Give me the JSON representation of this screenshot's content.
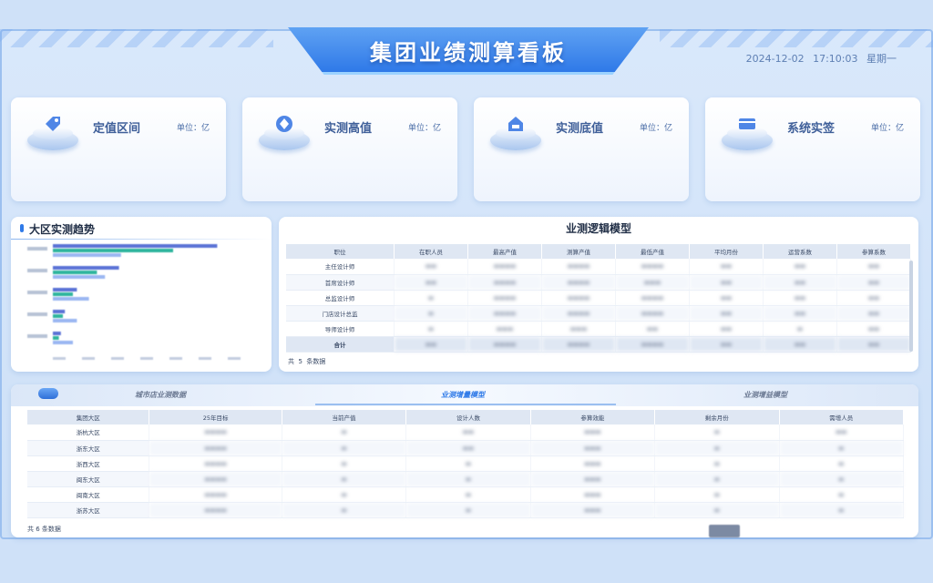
{
  "header": {
    "title": "集团业绩测算看板",
    "date": "2024-12-02",
    "time": "17:10:03",
    "weekday": "星期一"
  },
  "kpis": [
    {
      "label": "定值区间",
      "unit": "单位：亿",
      "icon": "tag-icon",
      "value": "",
      "sub": ""
    },
    {
      "label": "实测高值",
      "unit": "单位：亿",
      "icon": "diamond-icon",
      "value": "",
      "sub": ""
    },
    {
      "label": "实测底值",
      "unit": "单位：亿",
      "icon": "home-icon",
      "value": "",
      "sub": ""
    },
    {
      "label": "系统实签",
      "unit": "单位：亿",
      "icon": "card-icon",
      "value": "",
      "sub": ""
    }
  ],
  "trend_panel": {
    "title": "大区实测趋势"
  },
  "chart_data": {
    "type": "bar",
    "orientation": "horizontal",
    "title": "大区实测趋势",
    "categories": [],
    "series": [],
    "colors": [
      "#5b73d6",
      "#2fb59e",
      "#9bb7f2"
    ]
  },
  "logic_panel": {
    "title": "业测逻辑模型",
    "columns": [
      "职位",
      "在职人员",
      "最高产值",
      "测算产值",
      "最低产值",
      "平均月份",
      "运营系数",
      "参算系数"
    ],
    "rows": [
      {
        "role": "主任设计师"
      },
      {
        "role": "首席设计师"
      },
      {
        "role": "总监设计师"
      },
      {
        "role": "门店设计总监"
      },
      {
        "role": "导师设计师"
      }
    ],
    "total_label": "合计",
    "count_prefix": "共",
    "count_value": "5",
    "count_suffix": "条数据"
  },
  "bottom_panel": {
    "tabs": [
      "城市店业测数据",
      "业测增量模型",
      "业测增益模型"
    ],
    "active_tab": 1,
    "columns": [
      "集团大区",
      "25年目标",
      "当前产值",
      "设计人数",
      "参算效能",
      "剩余月份",
      "需增人员"
    ],
    "rows": [
      {
        "region": "浙杭大区"
      },
      {
        "region": "浙东大区"
      },
      {
        "region": "浙西大区"
      },
      {
        "region": "闽东大区"
      },
      {
        "region": "闽南大区"
      },
      {
        "region": "浙苏大区"
      }
    ],
    "count_text": "共 6 条数据"
  }
}
